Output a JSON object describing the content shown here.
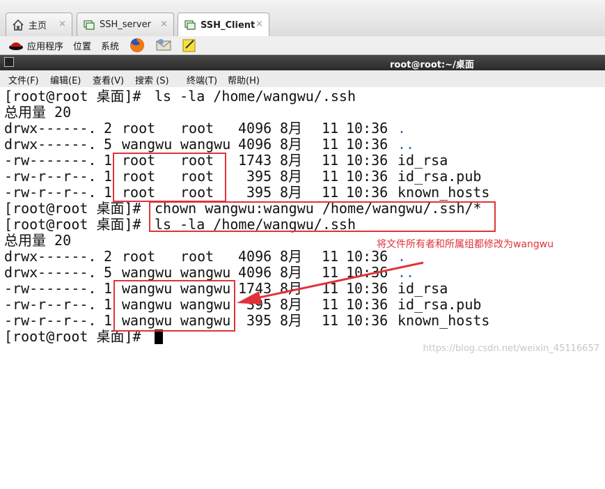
{
  "tabs": [
    {
      "label": "主页",
      "icon": "home-icon"
    },
    {
      "label": "SSH_server",
      "icon": "terminal-tab-icon"
    },
    {
      "label": "SSH_Client",
      "icon": "terminal-tab-icon",
      "active": true
    }
  ],
  "tab_close_glyph": "×",
  "appbar": {
    "applications": "应用程序",
    "places": "位置",
    "system": "系统"
  },
  "window_title": "root@root:~/桌面",
  "menus": [
    "文件(F)",
    "编辑(E)",
    "查看(V)",
    "搜索 (S)",
    "终端(T)",
    "帮助(H)"
  ],
  "terminal": {
    "prompt": "[root@root 桌面]#",
    "cmd1": "ls -la /home/wangwu/.ssh",
    "total1": "总用量 20",
    "listing1": [
      {
        "perms": "drwx------.",
        "links": "2",
        "owner": "root",
        "group": "root",
        "size": "4096",
        "month": "8月",
        "day": "11",
        "time": "10:36",
        "name": "."
      },
      {
        "perms": "drwx------.",
        "links": "5",
        "owner": "wangwu",
        "group": "wangwu",
        "size": "4096",
        "month": "8月",
        "day": "11",
        "time": "10:36",
        "name": ".."
      },
      {
        "perms": "-rw-------.",
        "links": "1",
        "owner": "root",
        "group": "root",
        "size": "1743",
        "month": "8月",
        "day": "11",
        "time": "10:36",
        "name": "id_rsa"
      },
      {
        "perms": "-rw-r--r--.",
        "links": "1",
        "owner": "root",
        "group": "root",
        "size": "395",
        "month": "8月",
        "day": "11",
        "time": "10:36",
        "name": "id_rsa.pub"
      },
      {
        "perms": "-rw-r--r--.",
        "links": "1",
        "owner": "root",
        "group": "root",
        "size": "395",
        "month": "8月",
        "day": "11",
        "time": "10:36",
        "name": "known_hosts"
      }
    ],
    "cmd2": "chown wangwu:wangwu /home/wangwu/.ssh/*",
    "cmd3": "ls -la /home/wangwu/.ssh",
    "total2": "总用量 20",
    "listing2": [
      {
        "perms": "drwx------.",
        "links": "2",
        "owner": "root",
        "group": "root",
        "size": "4096",
        "month": "8月",
        "day": "11",
        "time": "10:36",
        "name": "."
      },
      {
        "perms": "drwx------.",
        "links": "5",
        "owner": "wangwu",
        "group": "wangwu",
        "size": "4096",
        "month": "8月",
        "day": "11",
        "time": "10:36",
        "name": ".."
      },
      {
        "perms": "-rw-------.",
        "links": "1",
        "owner": "wangwu",
        "group": "wangwu",
        "size": "1743",
        "month": "8月",
        "day": "11",
        "time": "10:36",
        "name": "id_rsa"
      },
      {
        "perms": "-rw-r--r--.",
        "links": "1",
        "owner": "wangwu",
        "group": "wangwu",
        "size": "395",
        "month": "8月",
        "day": "11",
        "time": "10:36",
        "name": "id_rsa.pub"
      },
      {
        "perms": "-rw-r--r--.",
        "links": "1",
        "owner": "wangwu",
        "group": "wangwu",
        "size": "395",
        "month": "8月",
        "day": "11",
        "time": "10:36",
        "name": "known_hosts"
      }
    ]
  },
  "annotation": "将文件所有者和所属组都修改为wangwu",
  "watermark": "https://blog.csdn.net/weixin_45116657",
  "colors": {
    "annotation": "#e0323a",
    "dir_name": "#3a6fb0"
  }
}
